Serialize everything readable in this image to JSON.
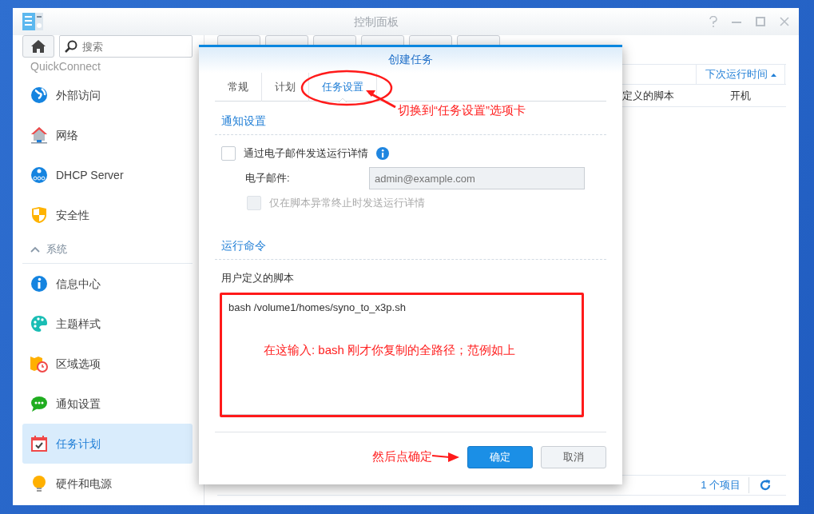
{
  "window": {
    "title": "控制面板"
  },
  "sidebar": {
    "search": {
      "placeholder": "搜索"
    },
    "items": [
      {
        "kind": "item",
        "label": "QuickConnect",
        "selected": false
      },
      {
        "kind": "item",
        "label": "外部访问",
        "selected": false
      },
      {
        "kind": "item",
        "label": "网络",
        "selected": false
      },
      {
        "kind": "item",
        "label": "DHCP Server",
        "selected": false
      },
      {
        "kind": "item",
        "label": "安全性",
        "selected": false
      },
      {
        "kind": "section",
        "label": "系统",
        "expanded": true
      },
      {
        "kind": "item",
        "label": "信息中心",
        "selected": false
      },
      {
        "kind": "item",
        "label": "主题样式",
        "selected": false
      },
      {
        "kind": "item",
        "label": "区域选项",
        "selected": false
      },
      {
        "kind": "item",
        "label": "通知设置",
        "selected": false
      },
      {
        "kind": "item",
        "label": "任务计划",
        "selected": true
      },
      {
        "kind": "item",
        "label": "硬件和电源",
        "selected": false
      }
    ]
  },
  "table": {
    "columns": [
      null,
      {
        "label": "下次运行时间",
        "sorted": true
      }
    ],
    "rows": [
      [
        "定义的脚本",
        "开机"
      ]
    ],
    "footer": {
      "count": "1 个项目"
    }
  },
  "dialog": {
    "title": "创建任务",
    "tabs": [
      {
        "label": "常规",
        "selected": false
      },
      {
        "label": "计划",
        "selected": false
      },
      {
        "label": "任务设置",
        "selected": true
      }
    ],
    "notification": {
      "title": "通知设置",
      "send_email": {
        "label": "通过电子邮件发送运行详情",
        "checked": false
      },
      "email": {
        "label": "电子邮件:",
        "placeholder": "admin@example.com",
        "disabled": true
      },
      "abort_only": {
        "label": "仅在脚本异常终止时发送运行详情",
        "checked": false,
        "disabled": true
      }
    },
    "command": {
      "title": "运行命令",
      "script_label": "用户定义的脚本",
      "script": "bash /volume1/homes/syno_to_x3p.sh"
    },
    "buttons": [
      {
        "label": "确定",
        "kind": "primary"
      },
      {
        "label": "取消",
        "kind": "secondary"
      }
    ]
  },
  "annotations": {
    "tab_hint": "切换到“任务设置”选项卡",
    "script_hint": "在这输入: bash  刚才你复制的全路径；范例如上",
    "ok_hint": "然后点确定"
  }
}
